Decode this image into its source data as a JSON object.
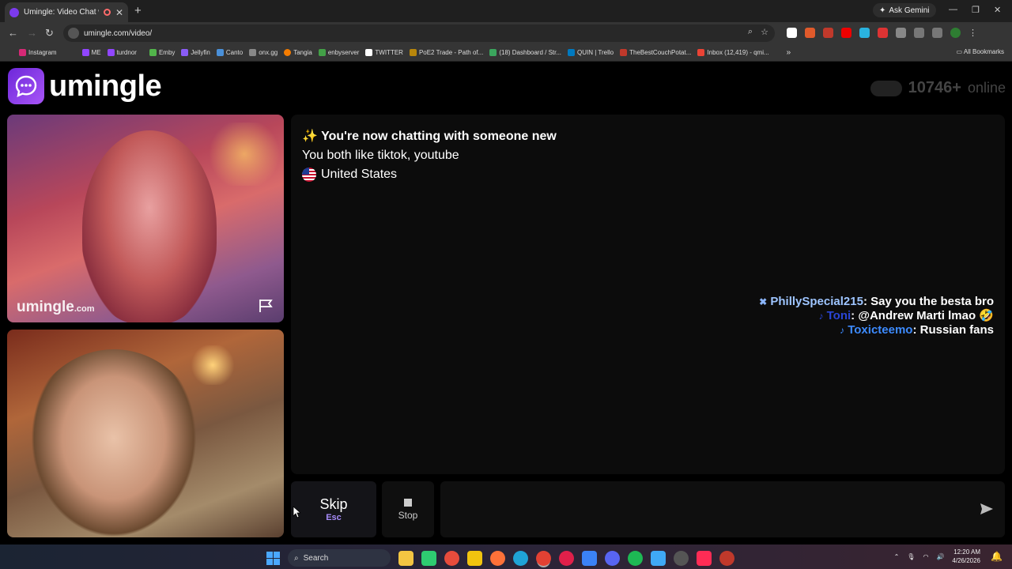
{
  "browser": {
    "tab_title": "Umingle: Video Chat with S",
    "new_tab_label": "+",
    "ask_gemini": "Ask Gemini",
    "url": "umingle.com/video/",
    "bookmarks": [
      "Instagram",
      "ME",
      "turdnor",
      "Emby",
      "Jellyfin",
      "Canto",
      "onx.gg",
      "Tangia",
      "enbyserver",
      "TWITTER",
      "PoE2 Trade - Path of...",
      "(18) Dashboard / Str...",
      "QUIN | Trello",
      "TheBestCouchPotat...",
      "Inbox (12,419) - qmi..."
    ],
    "all_bookmarks": "All Bookmarks"
  },
  "header": {
    "logo_text": "umingle",
    "online_count": "10746+",
    "online_label": "online"
  },
  "video": {
    "watermark_main": "umingle",
    "watermark_suffix": ".com"
  },
  "chat": {
    "headline": "✨ You're now chatting with someone new",
    "interests": "You both like tiktok, youtube",
    "country": "United States",
    "overlay": [
      {
        "name": "PhillySpecial215",
        "text": ": Say you the besta bro",
        "color": "#9ec5ff"
      },
      {
        "name": "Toni",
        "text": ": @Andrew Marti lmao 🤣",
        "color": "#2a45d6"
      },
      {
        "name": "Toxicteemo",
        "text": ": Russian fans",
        "color": "#3d8bff"
      }
    ]
  },
  "controls": {
    "skip_label": "Skip",
    "skip_key": "Esc",
    "stop_label": "Stop",
    "input_placeholder": ""
  },
  "taskbar": {
    "search_label": "Search",
    "time": "12:20 AM",
    "date": "4/26/2026"
  }
}
